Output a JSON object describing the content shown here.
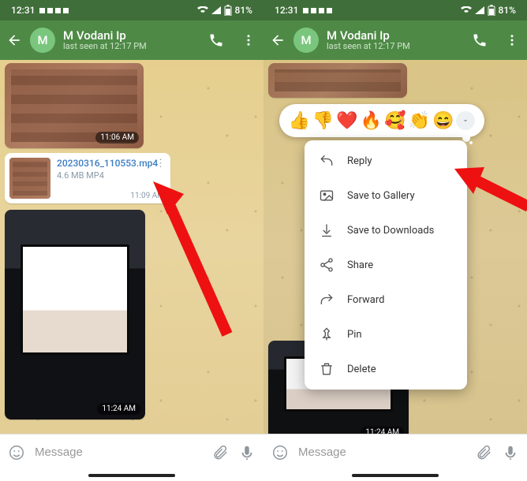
{
  "status": {
    "time": "12:31",
    "battery": "81%"
  },
  "header": {
    "avatar_initial": "M",
    "name": "M Vodani Ip",
    "subtitle": "last seen at 12:17 PM"
  },
  "messages": {
    "img1_time": "11:06 AM",
    "file": {
      "name": "20230316_110553.mp4",
      "meta": "4.6 MB MP4",
      "time": "11:09 AM"
    },
    "img2_time": "11:24 AM"
  },
  "input": {
    "placeholder": "Message"
  },
  "reactions": [
    "👍",
    "👎",
    "❤️",
    "🔥",
    "🥰",
    "👏",
    "😄"
  ],
  "menu": {
    "reply": "Reply",
    "save_gallery": "Save to Gallery",
    "save_downloads": "Save to Downloads",
    "share": "Share",
    "forward": "Forward",
    "pin": "Pin",
    "delete": "Delete"
  }
}
